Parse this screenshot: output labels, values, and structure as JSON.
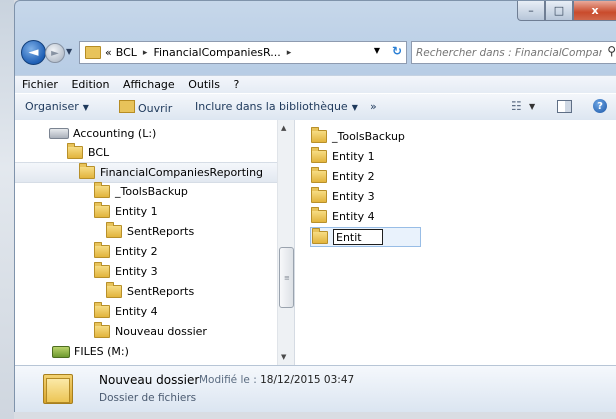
{
  "window": {
    "caption_buttons": {
      "minimize": "–",
      "maximize": "□",
      "close": "x"
    }
  },
  "address_bar": {
    "overflow": "«",
    "crumbs": [
      "BCL",
      "FinancialCompaniesR..."
    ],
    "separator": "▸",
    "search_placeholder": "Rechercher dans : FinancialCompani..."
  },
  "menu": [
    "Fichier",
    "Edition",
    "Affichage",
    "Outils",
    "?"
  ],
  "toolbar": {
    "organize": "Organiser",
    "open": "Ouvrir",
    "include": "Inclure dans la bibliothèque",
    "more": "»"
  },
  "nav_tree": [
    {
      "label": "Accounting (L:)",
      "icon": "drive-icon"
    },
    {
      "label": "BCL",
      "icon": "folder-icon"
    },
    {
      "label": "FinancialCompaniesReporting",
      "icon": "folder-icon",
      "selected": true
    },
    {
      "label": "_ToolsBackup",
      "icon": "folder-icon"
    },
    {
      "label": "Entity 1",
      "icon": "folder-icon"
    },
    {
      "label": "SentReports",
      "icon": "folder-icon"
    },
    {
      "label": "Entity 2",
      "icon": "folder-icon"
    },
    {
      "label": "Entity 3",
      "icon": "folder-icon"
    },
    {
      "label": "SentReports",
      "icon": "folder-icon"
    },
    {
      "label": "Entity 4",
      "icon": "folder-icon"
    },
    {
      "label": "Nouveau dossier",
      "icon": "folder-icon"
    },
    {
      "label": "FILES (M:)",
      "icon": "network-drive-icon"
    }
  ],
  "content_items": [
    "_ToolsBackup",
    "Entity 1",
    "Entity 2",
    "Entity 3",
    "Entity 4"
  ],
  "rename_value": "Entit",
  "details": {
    "name": "Nouveau dossier",
    "modified_label": "Modifié le :",
    "modified_value": "18/12/2015 03:47",
    "type": "Dossier de fichiers"
  }
}
